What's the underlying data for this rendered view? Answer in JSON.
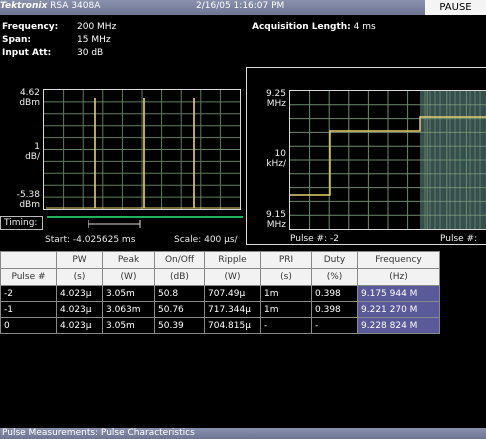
{
  "titlebar": {
    "brand": "Tektronix",
    "model": "RSA 3408A",
    "datetime": "2/16/05 1:16:07 PM",
    "pause_label": "PAUSE"
  },
  "params": {
    "frequency_label": "Frequency:",
    "frequency_value": "200 MHz",
    "span_label": "Span:",
    "span_value": "15 MHz",
    "input_att_label": "Input Att:",
    "input_att_value": "30 dB",
    "acq_label": "Acquisition Length:",
    "acq_value": "4 ms"
  },
  "left_plot": {
    "top_value": "4.62",
    "top_unit": "dBm",
    "scale_value": "1",
    "scale_unit": "dB/",
    "bottom_value": "-5.38",
    "bottom_unit": "dBm",
    "timing_label": "Timing:",
    "start_label": "Start: -4.025625 ms",
    "scale_label": "Scale: 400 µs/"
  },
  "right_plot": {
    "top_value": "9.25",
    "top_unit": "MHz",
    "scale_value": "10",
    "scale_unit": "kHz/",
    "bottom_value": "9.15",
    "bottom_unit": "MHz",
    "pulse_left": "Pulse #: -2",
    "pulse_right": "Pulse #:"
  },
  "table": {
    "headers_top": [
      "",
      "PW",
      "Peak",
      "On/Off",
      "Ripple",
      "PRI",
      "Duty",
      "Frequency"
    ],
    "headers_bottom": [
      "Pulse #",
      "(s)",
      "(W)",
      "(dB)",
      "(W)",
      "(s)",
      "(%)",
      "(Hz)"
    ],
    "rows": [
      [
        "-2",
        "4.023µ",
        "3.05m",
        "50.8",
        "707.49µ",
        "1m",
        "0.398",
        "9.175 944 M"
      ],
      [
        "-1",
        "4.023µ",
        "3.063m",
        "50.76",
        "717.344µ",
        "1m",
        "0.398",
        "9.221 270 M"
      ],
      [
        "0",
        "4.023µ",
        "3.05m",
        "50.39",
        "704.815µ",
        "-",
        "-",
        "9.228 824 M"
      ]
    ]
  },
  "status_text": "Pulse Measurements: Pulse Characteristics",
  "colors": {
    "trace": "#e8d070",
    "grid": "#5e7d5e",
    "timing_bar": "#1fb35a",
    "freq_cell": "#5a5a9a"
  }
}
